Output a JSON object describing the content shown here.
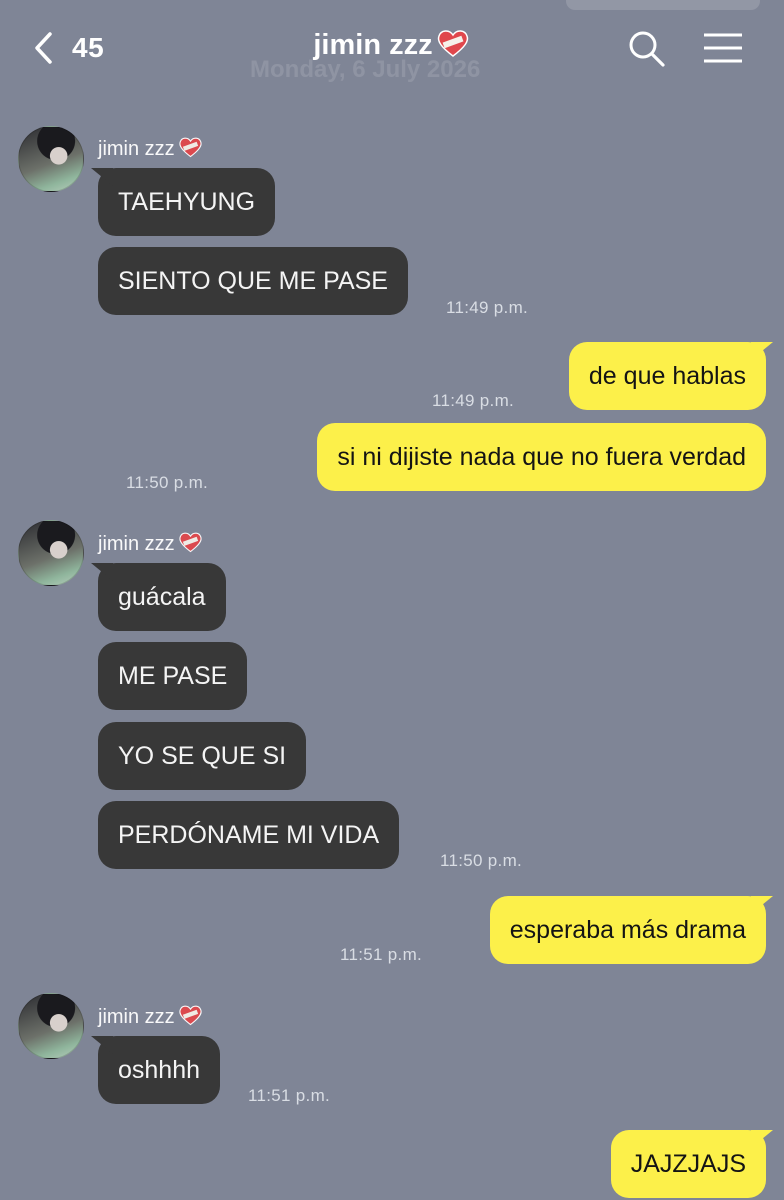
{
  "header": {
    "back_count": "45",
    "title": "jimin zzz",
    "date_ghost": "Monday, 6 July 2026"
  },
  "contact": {
    "name": "jimin zzz"
  },
  "colors": {
    "background": "#7f8596",
    "incoming_bubble": "#383838",
    "outgoing_bubble": "#fcf04a",
    "heart": "#e0474c"
  },
  "messages": [
    {
      "text": "TAEHYUNG"
    },
    {
      "text": "SIENTO QUE ME PASE",
      "time": "11:49 p.m."
    },
    {
      "text": "de que hablas",
      "time": "11:49 p.m."
    },
    {
      "text": "si ni dijiste nada que no fuera verdad",
      "time": "11:50 p.m."
    },
    {
      "text": "guácala"
    },
    {
      "text": "ME PASE"
    },
    {
      "text": "YO SE QUE SI"
    },
    {
      "text": "PERDÓNAME MI VIDA",
      "time": "11:50 p.m."
    },
    {
      "text": "esperaba más drama",
      "time": "11:51 p.m."
    },
    {
      "text": "oshhhh",
      "time": "11:51 p.m."
    },
    {
      "text": "JAJZJAJS"
    }
  ]
}
